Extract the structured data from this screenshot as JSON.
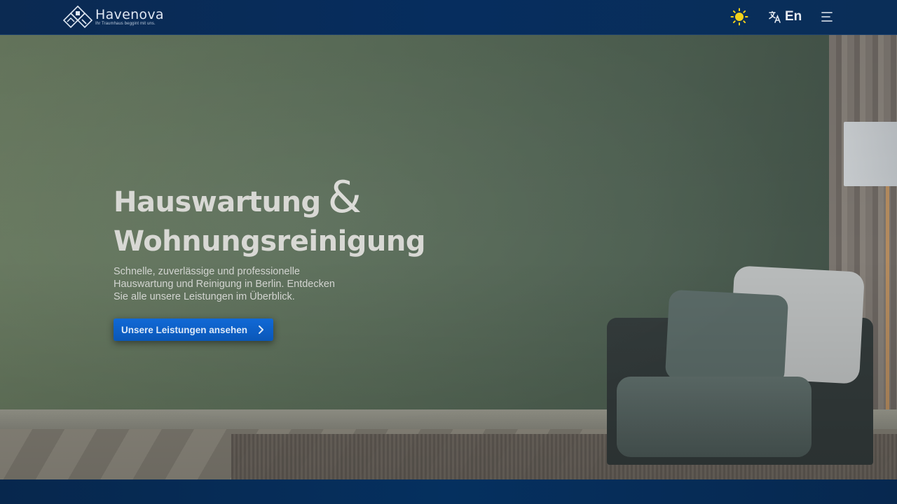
{
  "header": {
    "logo": {
      "name": "Havenova",
      "tagline": "Ihr Traumhaus beggint mit uns."
    },
    "theme_icon": "sun-icon",
    "language": {
      "icon": "translate-icon",
      "label": "En"
    },
    "menu_icon": "hamburger-menu-icon"
  },
  "hero": {
    "title_line1": "Hauswartung",
    "ampersand": "&",
    "title_line2": "Wohnungsreinigung",
    "subtitle": "Schnelle, zuverlässige und professionelle Hauswartung und Reinigung in Berlin. Entdecken Sie alle unsere Leistungen im Überblick.",
    "cta_label": "Unsere Leistungen ansehen",
    "cta_icon": "chevron-right-icon"
  },
  "colors": {
    "header_bg": "#062d5e",
    "accent": "#0a57b8",
    "sun": "#f3d21a"
  }
}
